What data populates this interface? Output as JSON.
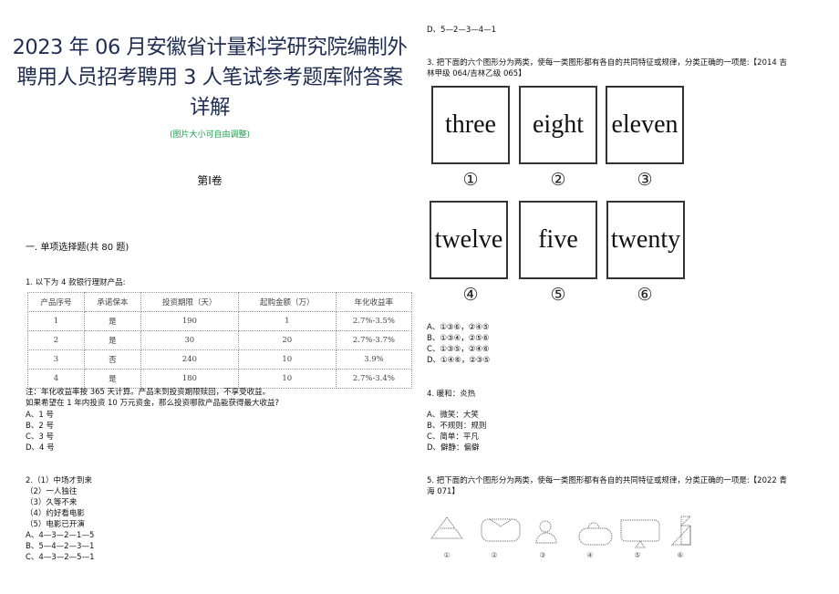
{
  "header": {
    "title_lines": [
      "2023 年 06 月安徽省计量科学研究院编制外",
      "聘用人员招考聘用 3 人笔试参考题库附答案",
      "详解"
    ],
    "subtitle": "(图片大小可自由调整)"
  },
  "volume": "第Ⅰ卷",
  "section": "一. 单项选择题(共 80 题)",
  "q1": {
    "stem": "1. 以下为 4 款银行理财产品:",
    "table": {
      "headers": [
        "产品序号",
        "承诺保本",
        "投资期限（天）",
        "起购金额（万）",
        "年化收益率"
      ],
      "rows": [
        [
          "1",
          "是",
          "190",
          "1",
          "2.7%-3.5%"
        ],
        [
          "2",
          "是",
          "30",
          "20",
          "2.7%-3.7%"
        ],
        [
          "3",
          "否",
          "240",
          "10",
          "3.9%"
        ],
        [
          "4",
          "是",
          "180",
          "10",
          "2.7%-3.4%"
        ]
      ]
    },
    "note": "注：年化收益率按 365 天计算。产品未到投资期限赎回，不享受收益。",
    "question": "如果希望在 1 年内投资 10 万元资金，那么投资哪款产品能获得最大收益?",
    "options": [
      "A、1 号",
      "B、2 号",
      "C、3 号",
      "D、4 号"
    ]
  },
  "q2": {
    "stem": "2.（1）中场才到来",
    "items": [
      "（2）一人独往",
      "（3）久等不来",
      "（4）约好看电影",
      "（5）电影已开演"
    ],
    "options": [
      "A、4—3—2—1—5",
      "B、5—4—2—3—1",
      "C、4—3—2—5—1",
      "D、5—2—3—4—1"
    ]
  },
  "q3": {
    "stem_lines": [
      "3. 把下面的六个图形分为两类，使每一类图形都有各自的共同特征或规律，分类正确的一项是:【2014 吉",
      "林甲级 064/吉林乙级 065】"
    ],
    "figures": [
      {
        "word": "three",
        "label": "①"
      },
      {
        "word": "eight",
        "label": "②"
      },
      {
        "word": "eleven",
        "label": "③"
      },
      {
        "word": "twelve",
        "label": "④"
      },
      {
        "word": "five",
        "label": "⑤"
      },
      {
        "word": "twenty",
        "label": "⑥"
      }
    ],
    "options": [
      "A、①③⑥，②④⑤",
      "B、①③④，②⑤⑥",
      "C、①③⑤，②④⑥",
      "D、①④⑥，②③⑤"
    ]
  },
  "q4": {
    "stem": "4. 暖和：炎热",
    "options": [
      "A、微笑：大笑",
      "B、不规则：规则",
      "C、简单：平凡",
      "D、僻静：偏僻"
    ]
  },
  "q5": {
    "stem_lines": [
      "5. 把下面的六个图形分为两类，使每一类图形都有各自的共同特征或规律，分类正确的一项是:【2022 青",
      "海 071】"
    ],
    "figures": [
      {
        "shape": "striped-triangle",
        "label": "①"
      },
      {
        "shape": "envelope-rounded-rect",
        "label": "②"
      },
      {
        "shape": "person-bust",
        "label": "③"
      },
      {
        "shape": "lock-shape",
        "label": "④"
      },
      {
        "shape": "monitor-on-stand",
        "label": "⑤"
      },
      {
        "shape": "zigzag-triangles",
        "label": "⑥"
      }
    ]
  }
}
